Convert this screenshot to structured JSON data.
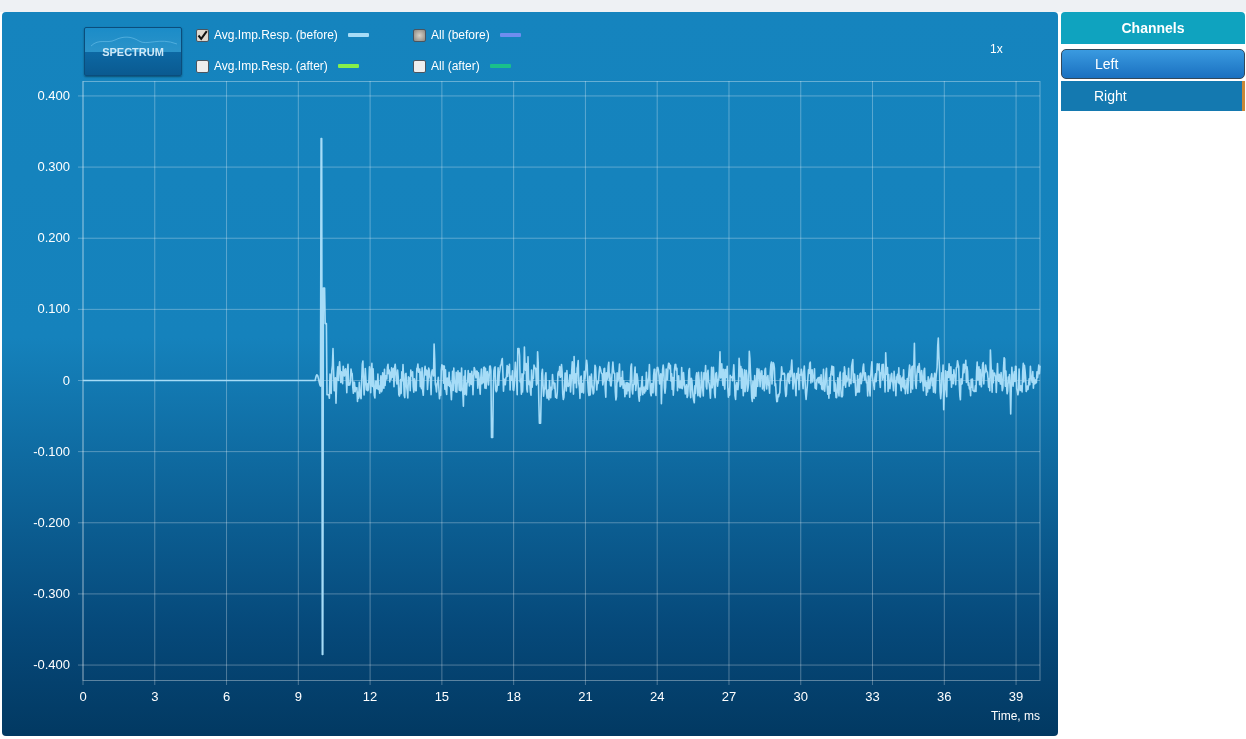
{
  "spectrum_button": {
    "label": "SPECTRUM"
  },
  "legend": [
    {
      "label": "Avg.Imp.Resp. (before)",
      "checked": true,
      "indeterminate": false,
      "color": "#a6dcf7"
    },
    {
      "label": "All (before)",
      "checked": false,
      "indeterminate": true,
      "color": "#6f8df0"
    },
    {
      "label": "Avg.Imp.Resp. (after)",
      "checked": false,
      "indeterminate": false,
      "color": "#86f04a"
    },
    {
      "label": "All (after)",
      "checked": false,
      "indeterminate": false,
      "color": "#19c08a"
    }
  ],
  "zoom_label": "1x",
  "plot": {
    "y_ticks": [
      "0.400",
      "0.300",
      "0.200",
      "0.100",
      "0",
      "-0.100",
      "-0.200",
      "-0.300",
      "-0.400"
    ],
    "x_ticks": [
      "0",
      "3",
      "6",
      "9",
      "12",
      "15",
      "18",
      "21",
      "24",
      "27",
      "30",
      "33",
      "36",
      "39"
    ],
    "x_axis_title": "Time, ms"
  },
  "channels": {
    "title": "Channels",
    "items": [
      {
        "label": "Left",
        "selected": true
      },
      {
        "label": "Right",
        "selected": false
      }
    ]
  }
}
